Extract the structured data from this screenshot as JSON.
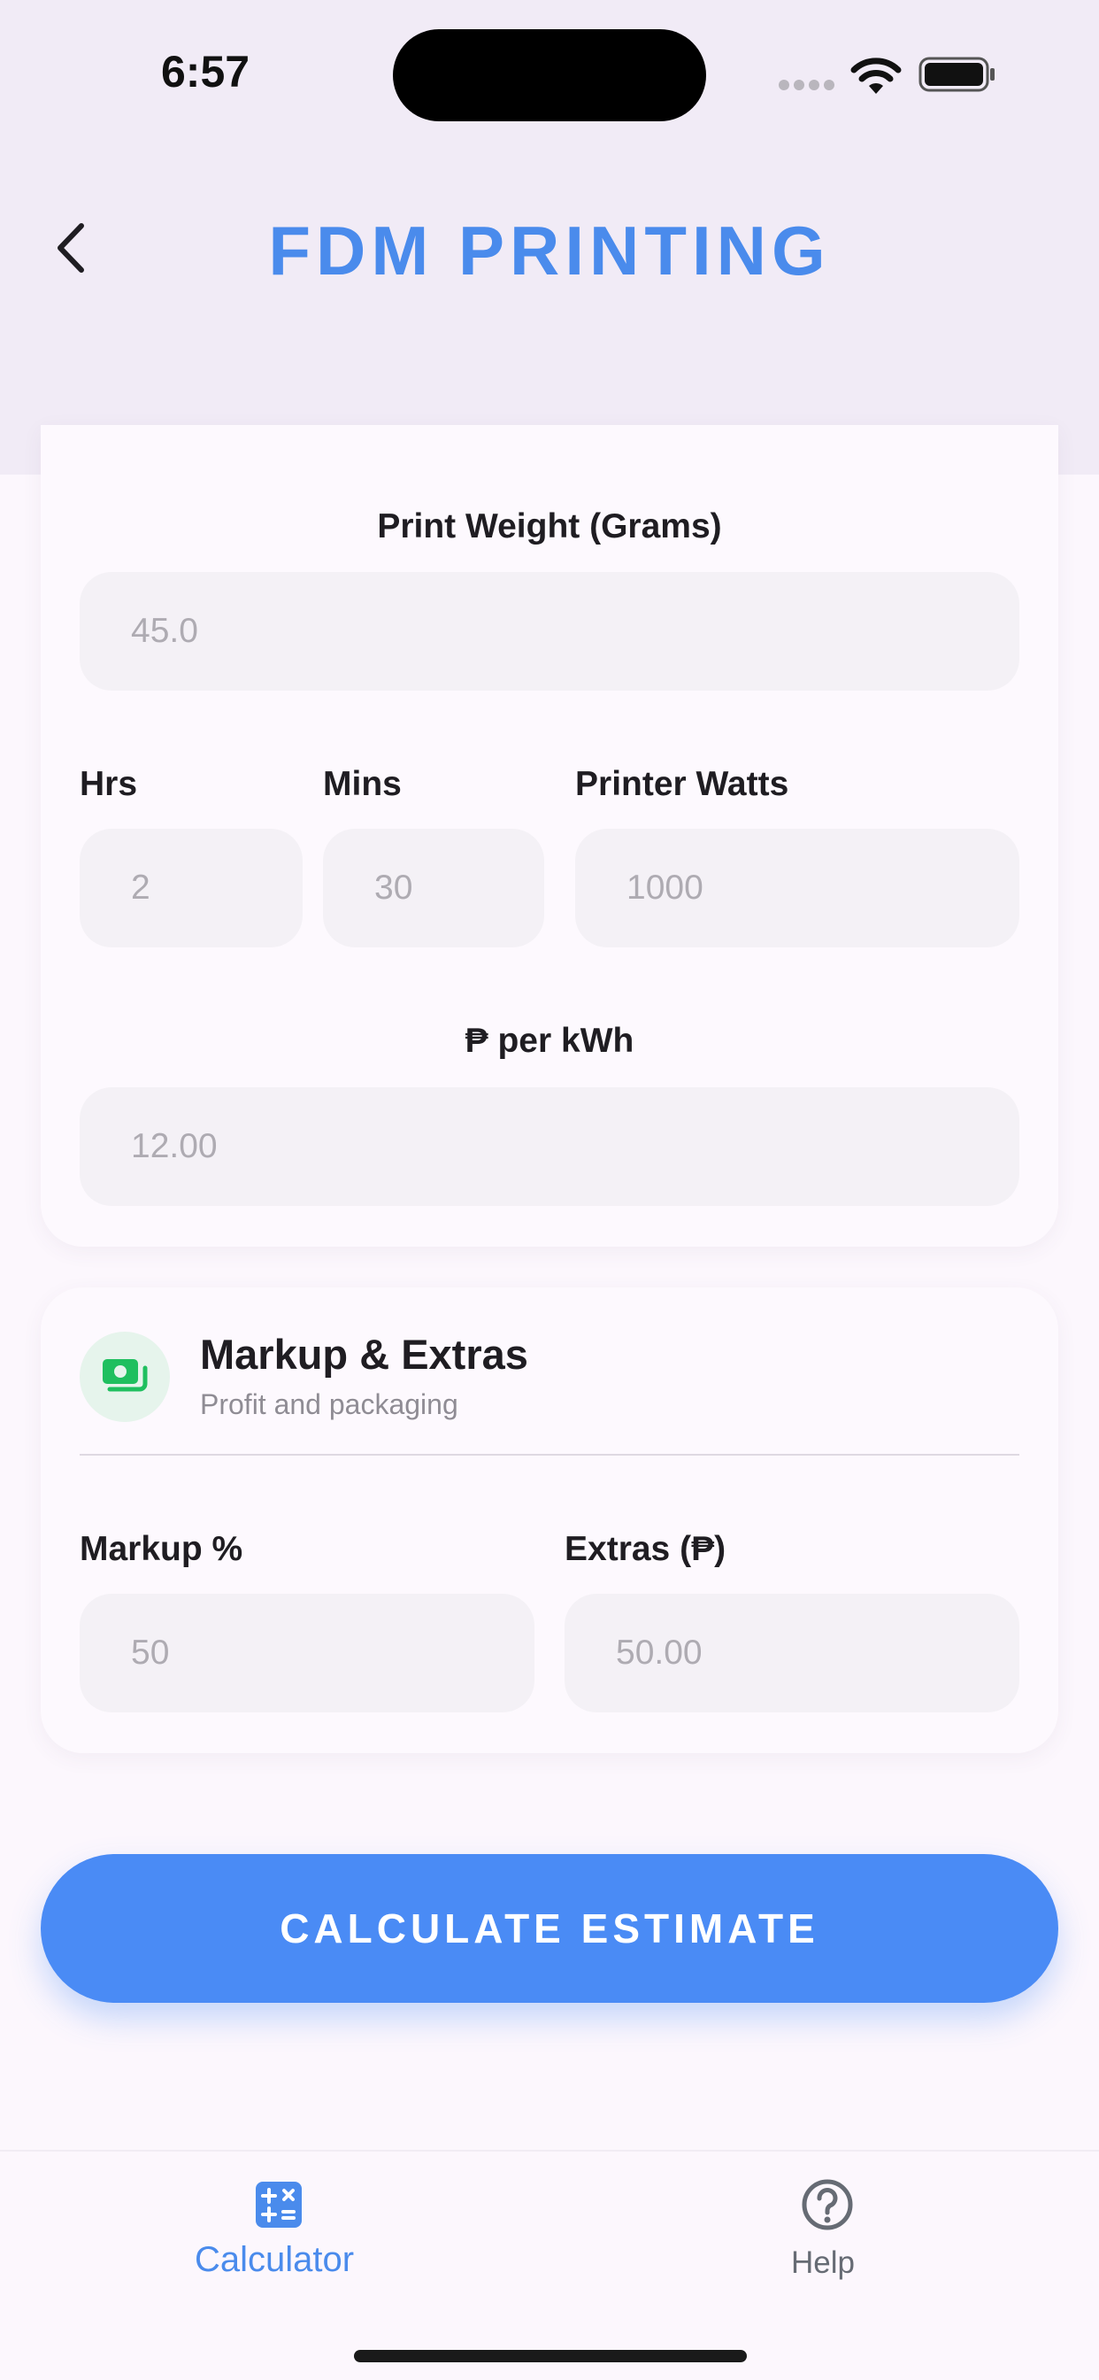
{
  "status_bar": {
    "time": "6:57"
  },
  "header": {
    "title": "FDM PRINTING",
    "back_icon": "chevron-left-icon"
  },
  "print_section": {
    "weight_label": "Print Weight (Grams)",
    "weight_placeholder": "45.0",
    "hrs_label": "Hrs",
    "hrs_placeholder": "2",
    "mins_label": "Mins",
    "mins_placeholder": "30",
    "watts_label": "Printer Watts",
    "watts_placeholder": "1000",
    "kwh_label": "₱ per kWh",
    "kwh_placeholder": "12.00"
  },
  "markup_section": {
    "icon": "cash-icon",
    "title": "Markup & Extras",
    "subtitle": "Profit and packaging",
    "markup_label": "Markup %",
    "markup_placeholder": "50",
    "extras_label": "Extras (₱)",
    "extras_placeholder": "50.00"
  },
  "actions": {
    "calculate_label": "CALCULATE ESTIMATE"
  },
  "bottom_nav": {
    "items": [
      {
        "label": "Calculator",
        "icon": "calculator-icon",
        "active": true
      },
      {
        "label": "Help",
        "icon": "help-circle-icon",
        "active": false
      }
    ]
  },
  "colors": {
    "accent": "#4a8bec",
    "button": "#4a8bf5",
    "money_icon": "#1fbf5f",
    "header_bg": "#f1ebf6",
    "page_bg": "#fcf7fd"
  }
}
